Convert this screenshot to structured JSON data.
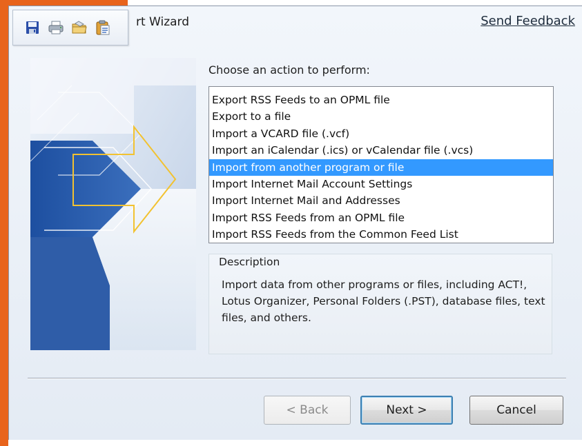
{
  "window": {
    "title_fragment": "rt Wizard",
    "send_feedback": "Send Feedback"
  },
  "quick_access": {
    "icons": [
      "save-icon",
      "print-icon",
      "open-folder-icon",
      "paste-icon"
    ]
  },
  "main": {
    "prompt": "Choose an action to perform:",
    "actions": [
      "Export RSS Feeds to an OPML file",
      "Export to a file",
      "Import a VCARD file (.vcf)",
      "Import an iCalendar (.ics) or vCalendar file (.vcs)",
      "Import from another program or file",
      "Import Internet Mail Account Settings",
      "Import Internet Mail and Addresses",
      "Import RSS Feeds from an OPML file",
      "Import RSS Feeds from the Common Feed List"
    ],
    "selected_index": 4,
    "description_label": "Description",
    "description_text": "Import data from other programs or files, including ACT!, Lotus Organizer, Personal Folders (.PST), database files, text files, and others."
  },
  "buttons": {
    "back": "< Back",
    "next": "Next >",
    "cancel": "Cancel"
  },
  "colors": {
    "selection": "#3399ff",
    "accent_orange": "#e8641c",
    "banner_blue": "#2f5da8"
  }
}
